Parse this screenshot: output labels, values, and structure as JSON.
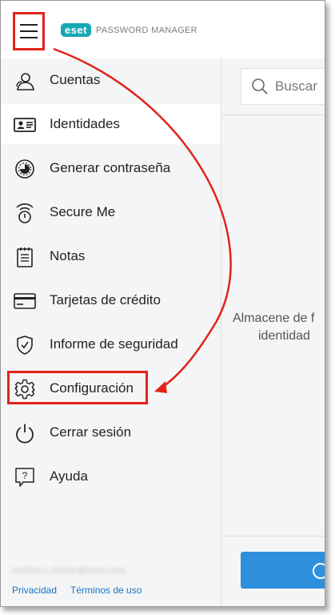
{
  "header": {
    "menu_icon": "hamburger-menu-icon",
    "logo_badge": "eset",
    "logo_text": "PASSWORD MANAGER"
  },
  "sidebar": {
    "items": [
      {
        "label": "Cuentas",
        "icon": "accounts-icon"
      },
      {
        "label": "Identidades",
        "icon": "id-card-icon",
        "active": true
      },
      {
        "label": "Generar contraseña",
        "icon": "password-generator-icon"
      },
      {
        "label": "Secure Me",
        "icon": "secure-me-icon"
      },
      {
        "label": "Notas",
        "icon": "notes-icon"
      },
      {
        "label": "Tarjetas de crédito",
        "icon": "credit-card-icon"
      },
      {
        "label": "Informe de seguridad",
        "icon": "shield-check-icon"
      },
      {
        "label": "Configuración",
        "icon": "gear-icon",
        "highlighted": true
      },
      {
        "label": "Cerrar sesión",
        "icon": "power-icon"
      },
      {
        "label": "Ayuda",
        "icon": "help-icon"
      }
    ],
    "footer": {
      "email": "emiliano.dolder@eset.com",
      "privacy_link": "Privacidad",
      "terms_link": "Términos de uso"
    }
  },
  "main": {
    "search_placeholder": "Buscar",
    "empty_line1": "Almacene de f",
    "empty_line2": "identidad"
  },
  "colors": {
    "highlight": "#e2231a",
    "accent": "#2e8fdc",
    "logo": "#18a7b5",
    "link": "#1a72c7"
  }
}
